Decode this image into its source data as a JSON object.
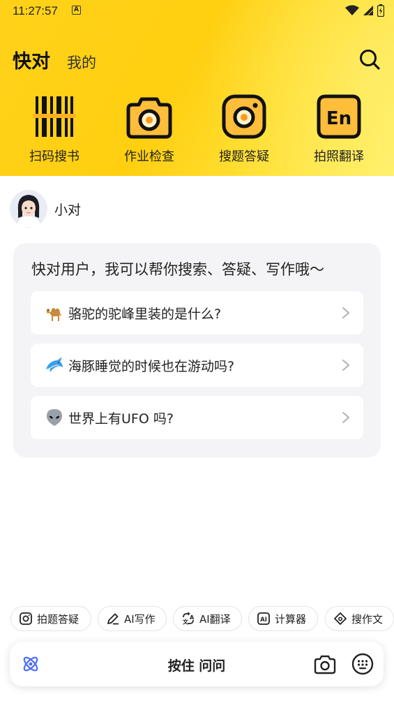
{
  "status_bar": {
    "time": "11:27:57",
    "notification_letter": "A"
  },
  "nav": {
    "title": "快对",
    "tab_mine": "我的",
    "search_icon": "search-icon"
  },
  "tools": [
    {
      "label": "扫码搜书",
      "icon": "barcode-icon"
    },
    {
      "label": "作业检查",
      "icon": "camera-icon"
    },
    {
      "label": "搜题答疑",
      "icon": "instagram-camera-icon"
    },
    {
      "label": "拍照翻译",
      "icon": "en-translate-icon"
    }
  ],
  "assistant": {
    "name": "小对"
  },
  "card": {
    "greeting": "快对用户，我可以帮你搜索、答疑、写作哦～",
    "questions": [
      {
        "emoji": "camel-icon",
        "text": "骆驼的驼峰里装的是什么?"
      },
      {
        "emoji": "dolphin-icon",
        "text": "海豚睡觉的时候也在游动吗?"
      },
      {
        "emoji": "alien-icon",
        "text": "世界上有UFO 吗?"
      }
    ]
  },
  "chips": [
    {
      "label": "拍题答疑",
      "icon": "camera-icon"
    },
    {
      "label": "AI写作",
      "icon": "pen-icon"
    },
    {
      "label": "AI翻译",
      "icon": "translate-icon"
    },
    {
      "label": "计算器",
      "icon": "ai-calculator-icon"
    },
    {
      "label": "搜作文",
      "icon": "essay-icon"
    }
  ],
  "input_bar": {
    "hold_label": "按住 问问"
  },
  "colors": {
    "header_yellow": "#ffd21a",
    "card_bg": "#f4f4f6",
    "accent_blue": "#4a6cf7"
  }
}
